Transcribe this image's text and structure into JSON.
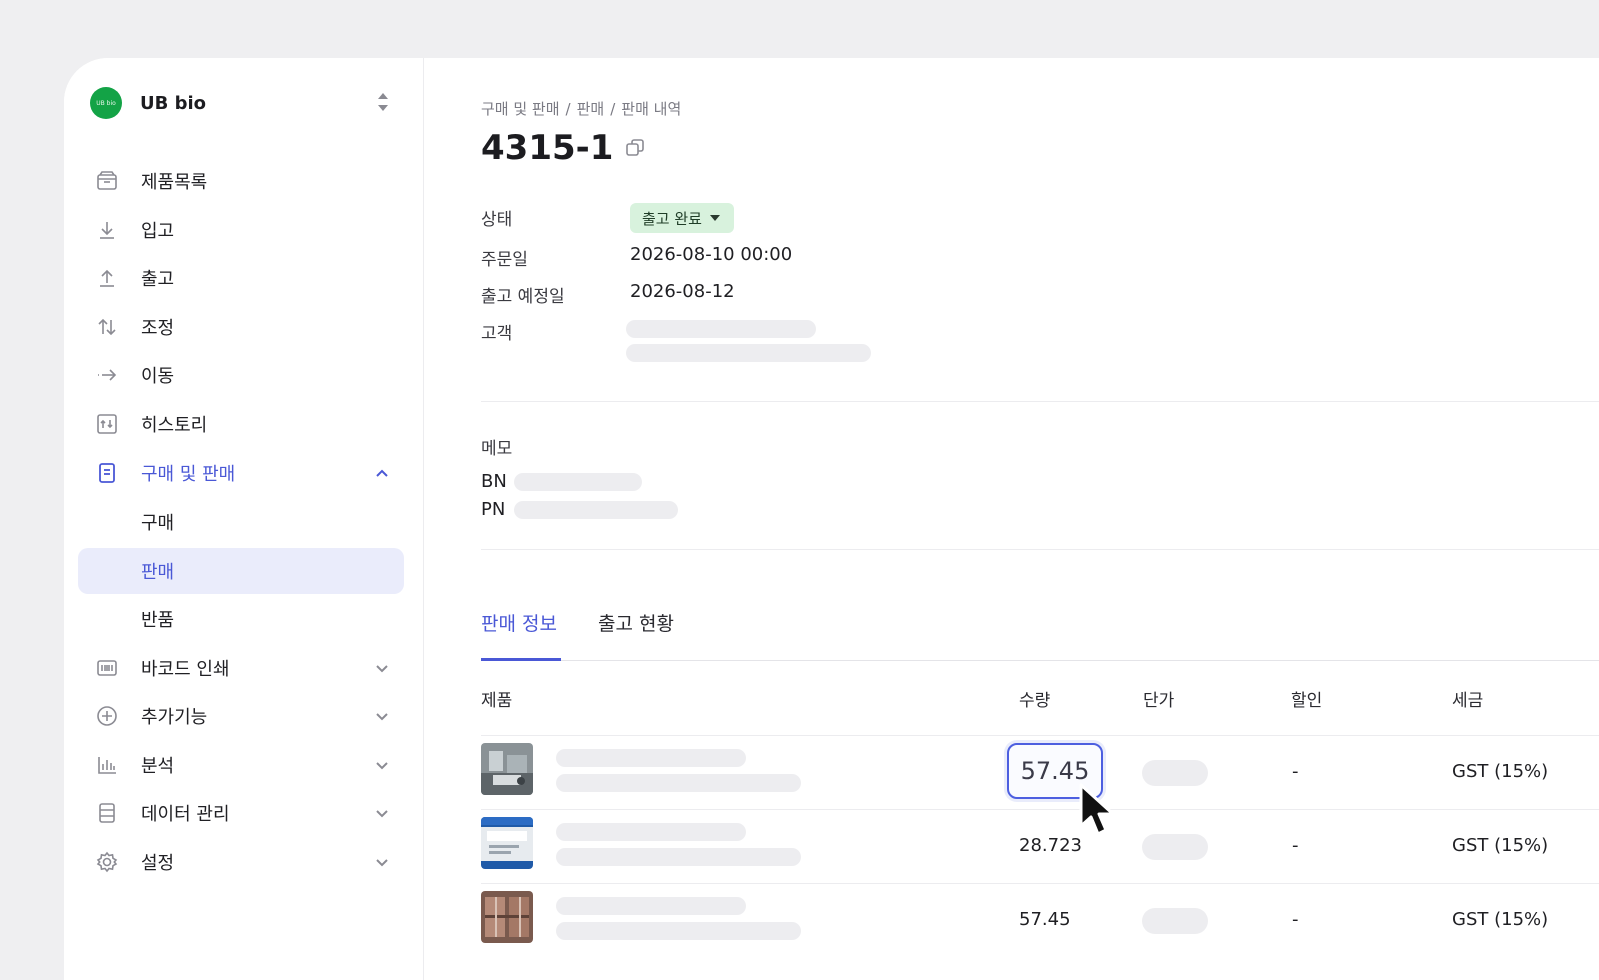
{
  "sidebar": {
    "org_name": "UB bio",
    "org_logo_text": "UB bio",
    "items": [
      {
        "label": "제품목록",
        "icon": "box-icon"
      },
      {
        "label": "입고",
        "icon": "arrow-down-icon"
      },
      {
        "label": "출고",
        "icon": "arrow-up-icon"
      },
      {
        "label": "조정",
        "icon": "swap-vertical-icon"
      },
      {
        "label": "이동",
        "icon": "arrow-right-icon"
      },
      {
        "label": "히스토리",
        "icon": "history-chart-icon"
      },
      {
        "label": "구매 및 판매",
        "icon": "document-icon",
        "expanded": true
      },
      {
        "label": "구매"
      },
      {
        "label": "판매",
        "selected": true
      },
      {
        "label": "반품"
      },
      {
        "label": "바코드 인쇄",
        "icon": "barcode-icon"
      },
      {
        "label": "추가기능",
        "icon": "plus-circle-icon"
      },
      {
        "label": "분석",
        "icon": "bar-chart-icon"
      },
      {
        "label": "데이터 관리",
        "icon": "database-icon"
      },
      {
        "label": "설정",
        "icon": "gear-icon"
      }
    ]
  },
  "breadcrumb": [
    "구매 및 판매",
    "판매",
    "판매 내역"
  ],
  "breadcrumb_sep": "/",
  "title": "4315-1",
  "fields": {
    "status_label": "상태",
    "status_value": "출고 완료",
    "order_date_label": "주문일",
    "order_date_value": "2026-08-10 00:00",
    "ship_date_label": "출고 예정일",
    "ship_date_value": "2026-08-12",
    "customer_label": "고객"
  },
  "memo": {
    "label": "메모",
    "bn_label": "BN",
    "pn_label": "PN"
  },
  "tabs": [
    {
      "label": "판매 정보",
      "active": true
    },
    {
      "label": "출고 현황",
      "active": false
    }
  ],
  "table": {
    "headers": [
      "제품",
      "수량",
      "단가",
      "할인",
      "세금"
    ],
    "rows": [
      {
        "qty": "57.45",
        "discount": "-",
        "tax": "GST (15%)",
        "editing": true
      },
      {
        "qty": "28.723",
        "discount": "-",
        "tax": "GST (15%)"
      },
      {
        "qty": "57.45",
        "discount": "-",
        "tax": "GST (15%)"
      }
    ]
  },
  "colors": {
    "accent": "#4a58d6",
    "status_bg": "#d8f2dd",
    "brand_green": "#13a346"
  }
}
